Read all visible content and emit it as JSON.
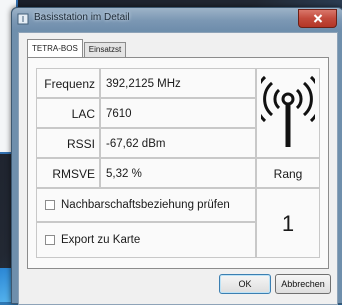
{
  "window": {
    "title": "Basisstation im Detail",
    "close_glyph": "x"
  },
  "tabs": [
    {
      "label": "TETRA-BOS"
    },
    {
      "label": "Einsatzst"
    }
  ],
  "fields": [
    {
      "label": "Frequenz",
      "value": "392,2125 MHz"
    },
    {
      "label": "LAC",
      "value": "7610"
    },
    {
      "label": "RSSI",
      "value": "-67,62 dBm"
    },
    {
      "label": "RMSVE",
      "value": "5,32 %"
    }
  ],
  "rank": {
    "label": "Rang",
    "value": "1"
  },
  "checkboxes": [
    {
      "label": "Nachbarschaftsbeziehung prüfen",
      "checked": false
    },
    {
      "label": "Export zu Karte",
      "checked": false
    }
  ],
  "buttons": {
    "ok": "OK",
    "cancel": "Abbrechen"
  },
  "icons": [
    "antenna-icon",
    "title-icon",
    "close-icon"
  ],
  "colors": {
    "antenna": "#111111",
    "close": "#c24a3c",
    "titlebar": "#7c98b4"
  }
}
